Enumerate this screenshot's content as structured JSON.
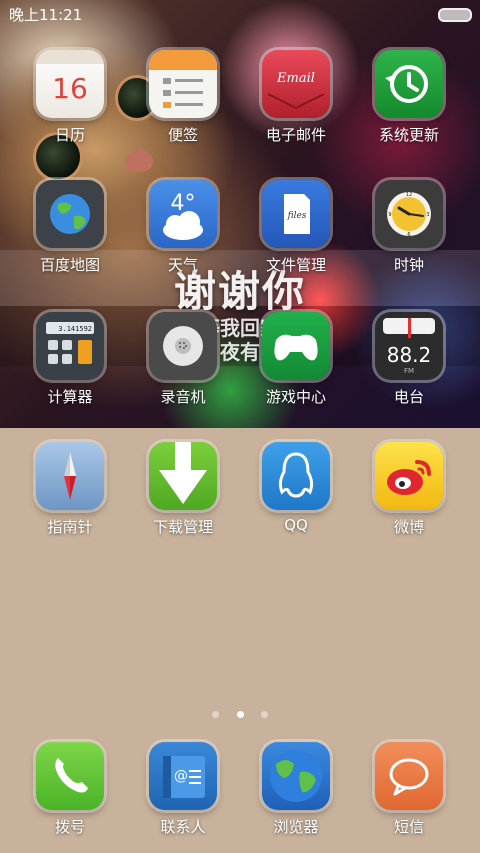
{
  "status_bar": {
    "time": "晚上11:21"
  },
  "wallpaper_text": {
    "line1": "谢谢你",
    "line2": "等我回家",
    "line3": "夜有"
  },
  "rows": [
    [
      {
        "name": "calendar",
        "label": "日历",
        "icon": "calendar-icon",
        "value": "16"
      },
      {
        "name": "notes",
        "label": "便签",
        "icon": "notes-icon"
      },
      {
        "name": "email",
        "label": "电子邮件",
        "icon": "email-icon",
        "value": "Email"
      },
      {
        "name": "system-update",
        "label": "系统更新",
        "icon": "update-icon"
      }
    ],
    [
      {
        "name": "baidu-map",
        "label": "百度地图",
        "icon": "globe-icon"
      },
      {
        "name": "weather",
        "label": "天气",
        "icon": "weather-icon",
        "value": "4°"
      },
      {
        "name": "file-manager",
        "label": "文件管理",
        "icon": "files-icon",
        "value": "files"
      },
      {
        "name": "clock",
        "label": "时钟",
        "icon": "clock-icon"
      }
    ],
    [
      {
        "name": "calculator",
        "label": "计算器",
        "icon": "calculator-icon",
        "value": "3.141592"
      },
      {
        "name": "recorder",
        "label": "录音机",
        "icon": "microphone-icon"
      },
      {
        "name": "game-center",
        "label": "游戏中心",
        "icon": "gamepad-icon"
      },
      {
        "name": "radio",
        "label": "电台",
        "icon": "radio-icon",
        "value": "88.2",
        "unit": "FM"
      }
    ],
    [
      {
        "name": "compass",
        "label": "指南针",
        "icon": "compass-icon"
      },
      {
        "name": "download-manager",
        "label": "下载管理",
        "icon": "download-icon"
      },
      {
        "name": "qq",
        "label": "QQ",
        "icon": "qq-penguin-icon"
      },
      {
        "name": "weibo",
        "label": "微博",
        "icon": "weibo-icon"
      }
    ]
  ],
  "dock": [
    {
      "name": "phone",
      "label": "拨号",
      "icon": "phone-icon"
    },
    {
      "name": "contacts",
      "label": "联系人",
      "icon": "contacts-icon"
    },
    {
      "name": "browser",
      "label": "浏览器",
      "icon": "browser-globe-icon"
    },
    {
      "name": "messages",
      "label": "短信",
      "icon": "message-bubble-icon"
    }
  ],
  "page_indicator": {
    "pages": 3,
    "current": 2
  }
}
